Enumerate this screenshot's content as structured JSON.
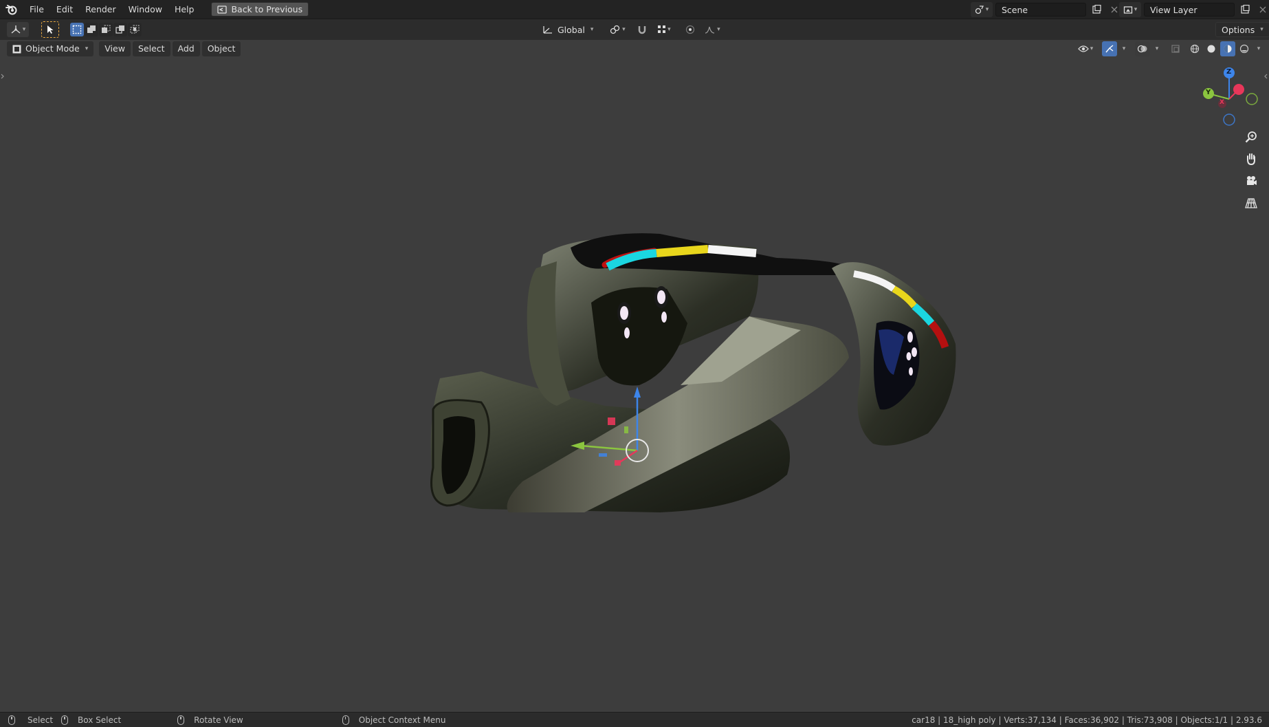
{
  "menu": {
    "items": [
      "File",
      "Edit",
      "Render",
      "Window",
      "Help"
    ],
    "back_button": "Back to Previous"
  },
  "scene": {
    "label": "Scene",
    "view_layer": "View Layer"
  },
  "tool_header": {
    "orientation": "Global",
    "options": "Options"
  },
  "viewport_header": {
    "mode": "Object Mode",
    "menus": [
      "View",
      "Select",
      "Add",
      "Object"
    ]
  },
  "gizmo": {
    "x": "X",
    "y": "Y",
    "z": "Z"
  },
  "status": {
    "select": "Select",
    "box_select": "Box Select",
    "rotate_view": "Rotate View",
    "context_menu": "Object Context Menu",
    "stats": "car18 | 18_high poly | Verts:37,134 | Faces:36,902 | Tris:73,908 | Objects:1/1 | 2.93.6"
  },
  "colors": {
    "accent": "#4772b3",
    "axis_x": "#e8375a",
    "axis_y": "#8bc53f",
    "axis_z": "#3d85ea"
  }
}
